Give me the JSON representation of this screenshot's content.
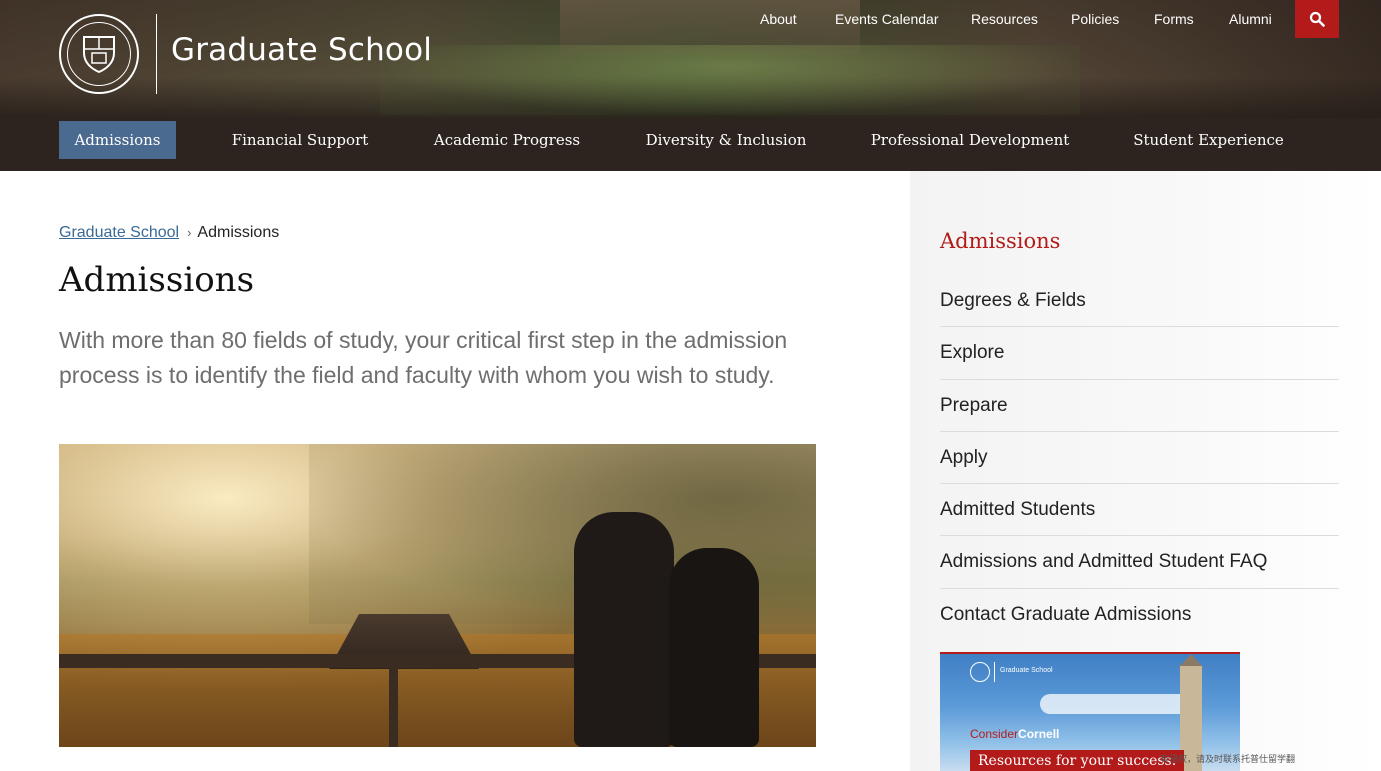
{
  "header": {
    "site_title": "Graduate School",
    "seal_text": "CORNELL UNIVERSITY FOUNDED A.D. 1865",
    "utility_nav": [
      "About",
      "Events Calendar",
      "Resources",
      "Policies",
      "Forms",
      "Alumni"
    ],
    "search_icon": "search-icon",
    "main_nav": [
      "Admissions",
      "Financial Support",
      "Academic Progress",
      "Diversity & Inclusion",
      "Professional Development",
      "Student Experience"
    ],
    "active_nav": "Admissions"
  },
  "breadcrumb": {
    "home": "Graduate School",
    "separator": "›",
    "current": "Admissions"
  },
  "main": {
    "title": "Admissions",
    "intro": "With more than 80 fields of study, your critical first step in the admission process is to identify the field and faculty with whom you wish to study."
  },
  "sidebar": {
    "title": "Admissions",
    "items": [
      "Degrees & Fields",
      "Explore",
      "Prepare",
      "Apply",
      "Admitted Students",
      "Admissions and Admitted Student FAQ",
      "Contact Graduate Admissions"
    ]
  },
  "promo": {
    "mini_title": "Graduate School",
    "consider_prefix": "Consider",
    "consider_bold": "Cornell",
    "banner": "Resources for your success."
  },
  "overlay_note": "有侵权，请及时联系托普仕留学翻",
  "colors": {
    "accent_red": "#b31b1b",
    "nav_active": "#4b6a8f",
    "link_blue": "#3a6a95"
  }
}
